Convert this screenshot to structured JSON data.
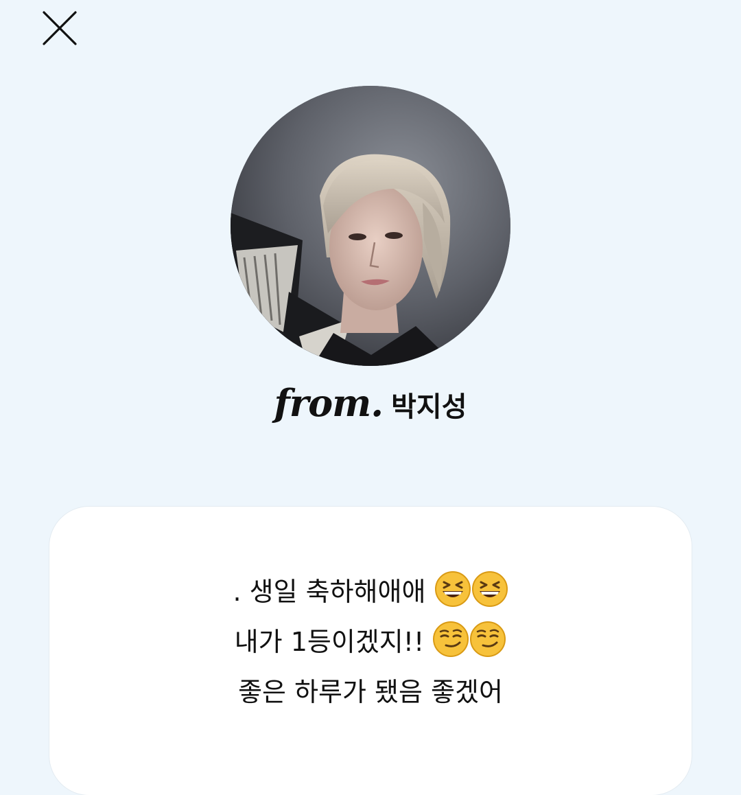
{
  "header": {
    "close_icon": "close-icon"
  },
  "sender": {
    "avatar_icon": "profile-photo",
    "from_label": "from.",
    "name": "박지성"
  },
  "message": {
    "lines": [
      {
        "text": ". 생일 축하해애애 ",
        "emojis": [
          "grinning-squinting-face",
          "grinning-squinting-face"
        ]
      },
      {
        "text": "내가 1등이겠지!! ",
        "emojis": [
          "smirking-face",
          "smirking-face"
        ]
      },
      {
        "text": "좋은 하루가 됐음 좋겠어",
        "emojis": []
      }
    ]
  },
  "colors": {
    "background": "#eef6fc",
    "card": "#ffffff",
    "text": "#111111",
    "emoji_face": "#f7c23b"
  }
}
